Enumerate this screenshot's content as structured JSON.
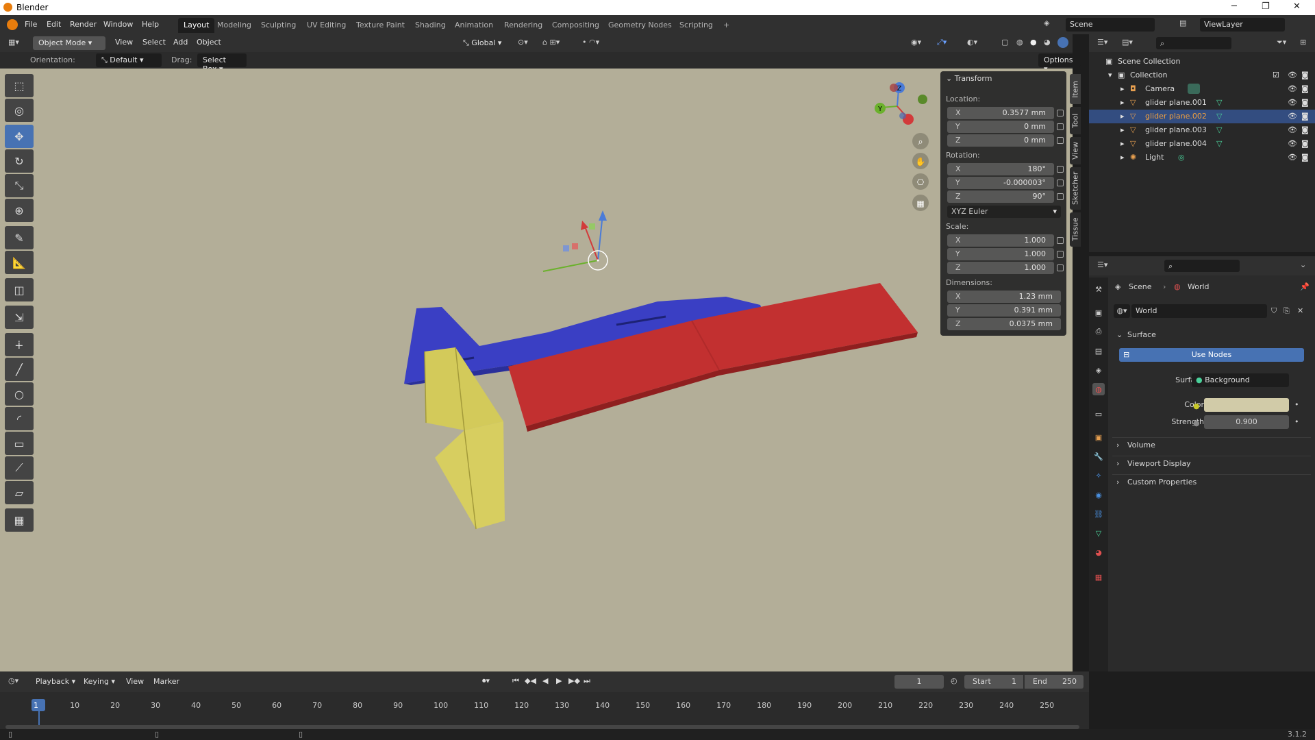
{
  "app": {
    "title": "Blender",
    "version": "3.1.2"
  },
  "menus": [
    "File",
    "Edit",
    "Render",
    "Window",
    "Help"
  ],
  "workspaces": [
    "Layout",
    "Modeling",
    "Sculpting",
    "UV Editing",
    "Texture Paint",
    "Shading",
    "Animation",
    "Rendering",
    "Compositing",
    "Geometry Nodes",
    "Scripting",
    "+"
  ],
  "scene": {
    "label": "Scene",
    "view_layer": "ViewLayer"
  },
  "viewport_header": {
    "mode": "Object Mode",
    "menus": [
      "View",
      "Select",
      "Add",
      "Object"
    ],
    "transform": "Global"
  },
  "tool_header": {
    "orientation_label": "Orientation:",
    "orientation": "Default",
    "drag_label": "Drag:",
    "drag": "Select Box",
    "options": "Options"
  },
  "transform": {
    "title": "Transform",
    "location_label": "Location:",
    "location": {
      "x": "0.3577 mm",
      "y": "0 mm",
      "z": "0 mm"
    },
    "rotation_label": "Rotation:",
    "rotation": {
      "x": "180°",
      "y": "-0.000003°",
      "z": "90°"
    },
    "rotation_mode": "XYZ Euler",
    "scale_label": "Scale:",
    "scale": {
      "x": "1.000",
      "y": "1.000",
      "z": "1.000"
    },
    "dimensions_label": "Dimensions:",
    "dimensions": {
      "x": "1.23 mm",
      "y": "0.391 mm",
      "z": "0.0375 mm"
    }
  },
  "axis_labels": {
    "x": "X",
    "y": "Y",
    "z": "Z"
  },
  "sidebar_tabs": [
    "Item",
    "Tool",
    "View",
    "Sketcher",
    "Tissue"
  ],
  "outliner": {
    "root": "Scene Collection",
    "collection": "Collection",
    "items": [
      {
        "name": "Camera",
        "selected": false
      },
      {
        "name": "glider plane.001",
        "selected": false
      },
      {
        "name": "glider plane.002",
        "selected": true
      },
      {
        "name": "glider plane.003",
        "selected": false
      },
      {
        "name": "glider plane.004",
        "selected": false
      },
      {
        "name": "Light",
        "selected": false
      }
    ]
  },
  "properties": {
    "breadcrumb": [
      "Scene",
      "World"
    ],
    "world_name": "World",
    "surface_panel": "Surface",
    "use_nodes": "Use Nodes",
    "surface_label": "Surface",
    "surface_value": "Background",
    "color_label": "Color",
    "strength_label": "Strength",
    "strength_value": "0.900",
    "collapsed_panels": [
      "Volume",
      "Viewport Display",
      "Custom Properties"
    ],
    "world_color": "#d1cba8"
  },
  "timeline": {
    "menus": [
      "Playback",
      "Keying",
      "View",
      "Marker"
    ],
    "current_frame": "1",
    "start_label": "Start",
    "start": "1",
    "end_label": "End",
    "end": "250",
    "ticks": [
      "1",
      "10",
      "20",
      "30",
      "40",
      "50",
      "60",
      "70",
      "80",
      "90",
      "100",
      "110",
      "120",
      "130",
      "140",
      "150",
      "160",
      "170",
      "180",
      "190",
      "200",
      "210",
      "220",
      "230",
      "240",
      "250"
    ]
  },
  "colors": {
    "accent": "#4772b3",
    "viewport_bg": "#b3ae98",
    "wing_red": "#c23030",
    "fuselage_blue": "#3a3fc4",
    "tail_yellow": "#d3ca5a"
  }
}
